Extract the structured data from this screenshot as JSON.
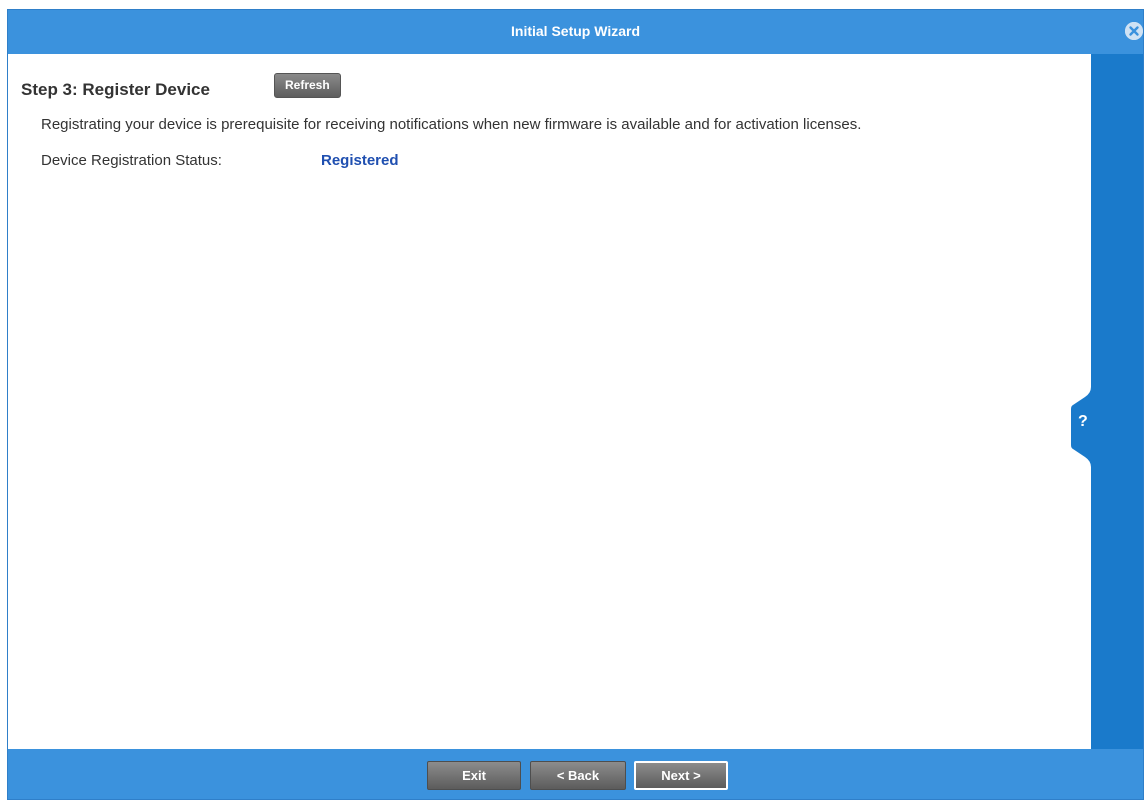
{
  "window": {
    "title": "Initial Setup Wizard"
  },
  "step": {
    "title": "Step 3: Register Device",
    "refresh_label": "Refresh",
    "description": "Registrating your device is prerequisite for receiving notifications when new firmware is available and for activation licenses.",
    "status_label": "Device Registration Status:",
    "status_value": "Registered"
  },
  "help": {
    "label": "?"
  },
  "footer": {
    "exit_label": "Exit",
    "back_label": "< Back",
    "next_label": "Next >"
  },
  "colors": {
    "header": "#3b92dd",
    "help_strip": "#1a7acb",
    "status_value": "#1f4fb0"
  },
  "icons": {
    "close": "close-circle-icon",
    "help": "question-icon"
  }
}
